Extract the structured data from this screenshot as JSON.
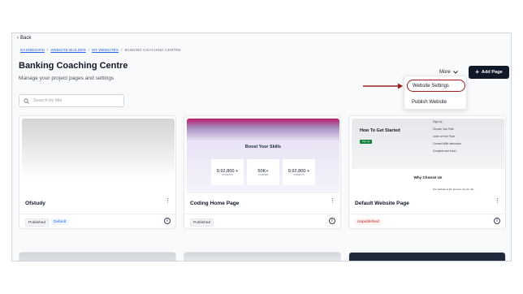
{
  "nav": {
    "back_label": "Back"
  },
  "breadcrumb": {
    "items": [
      "DASHBOARD",
      "WEBSITE BUILDER",
      "MY WEBSITES",
      "BANKING COACHING CENTRE"
    ],
    "separator": "/"
  },
  "header": {
    "title": "Banking Coaching Centre",
    "subtitle": "Manage your project pages and settings",
    "more_label": "More",
    "add_page_label": "Add Page"
  },
  "menu": {
    "items": [
      "Website Settings",
      "Publish Website"
    ]
  },
  "search": {
    "placeholder": "Search by title"
  },
  "cards": [
    {
      "name": "Ofstudy",
      "status": "Published",
      "default_label": "Default"
    },
    {
      "name": "Coding Home Page",
      "status": "Published",
      "preview": {
        "heading": "Boost Your Skills",
        "stats": [
          {
            "value": "9,92,800 +",
            "label": "STUDENTS"
          },
          {
            "value": "50K+",
            "label": "COURSES"
          },
          {
            "value": "9,92,800 +",
            "label": "SUBJECTS"
          }
        ]
      }
    },
    {
      "name": "Default Website Page",
      "status": "Unpublished",
      "preview": {
        "heading": "How To Get Started",
        "button": "Sign Up",
        "steps": [
          "Sign Up",
          "Choose Your Path",
          "Learn at Your Pace",
          "Connect With Instructors",
          "Complete and Excel"
        ],
        "section": "Why Choose Us",
        "footnote": "Our website is the premier one for the..."
      }
    }
  ],
  "colors": {
    "accent_red": "#9b1c1c",
    "primary_dark": "#111827",
    "link_blue": "#2563eb"
  }
}
